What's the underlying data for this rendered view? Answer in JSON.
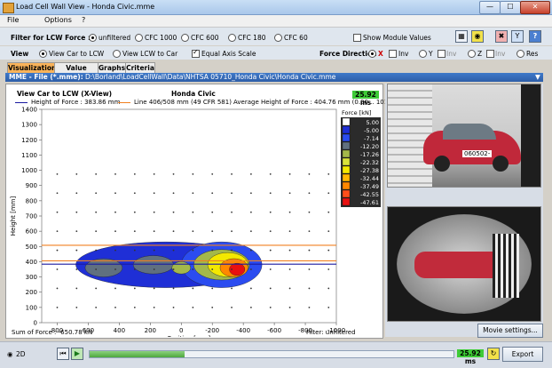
{
  "window": {
    "title": "Load Cell Wall View - Honda Civic.mme",
    "controls": {
      "minimize": "—",
      "maximize": "☐",
      "close": "✕"
    }
  },
  "menu": [
    "File",
    "Options",
    "?"
  ],
  "filter": {
    "label": "Filter for LCW Force :",
    "options": [
      "unfiltered",
      "CFC 1000",
      "CFC 600",
      "CFC 180",
      "CFC 60"
    ],
    "selected": "unfiltered",
    "show_module_values": "Show Module Values"
  },
  "view": {
    "label": "View",
    "options": [
      "View Car to LCW",
      "View LCW to Car"
    ],
    "selected": "View Car to LCW",
    "equal_axis_scale": "Equal Axis Scale",
    "force_direction_label": "Force Direction",
    "force_options": [
      "X",
      "Inv",
      "Y",
      "Inv",
      "Z",
      "Inv",
      "Res"
    ]
  },
  "tabs": [
    "Visualization",
    "Value Tables",
    "Graphs",
    "Criteria"
  ],
  "mme_file": {
    "label": "MME - File (*.mme):",
    "path": "D:\\Borland\\LoadCellWall\\Data\\NHTSA 05710_Honda Civic\\Honda Civic.mme"
  },
  "chart": {
    "header_left": "View Car to LCW (X-View)",
    "header_center": "Honda Civic",
    "time": "25.92 ms",
    "legend_height": "Height of Force : 383.86 mm",
    "legend_line": "Line 406/508 mm (49 CFR 581)",
    "avg_height": "Average Height of Force : 404.76 mm (0.00 .. 101.04 ms)",
    "sum_force": "Sum of Force : -650.78 kN",
    "filter_status": "Filter: unfiltered",
    "colorbar_title": "Force [kN]"
  },
  "chart_data": {
    "type": "heatmap",
    "xlabel": "Position [mm]",
    "ylabel": "Height [mm]",
    "xlim": [
      900,
      -1000
    ],
    "ylim": [
      0,
      1400
    ],
    "x_ticks": [
      800,
      600,
      400,
      200,
      0,
      -200,
      -400,
      -600,
      -800,
      -1000
    ],
    "y_ticks": [
      0,
      100,
      200,
      300,
      400,
      500,
      600,
      700,
      800,
      900,
      1000,
      1100,
      1200,
      1300,
      1400
    ],
    "lines": [
      {
        "name": "Height of Force",
        "y": 383.86,
        "color": "#1a1aa0"
      },
      {
        "name": "Line 406 mm",
        "y": 406,
        "color": "#f08020"
      },
      {
        "name": "Line 508 mm",
        "y": 508,
        "color": "#f08020"
      }
    ],
    "legend_levels": [
      {
        "value": "5.00",
        "color": "#ffffff"
      },
      {
        "value": "-5.00",
        "color": "#1f2fd6"
      },
      {
        "value": "-7.14",
        "color": "#2b4cf0"
      },
      {
        "value": "-12.20",
        "color": "#607080"
      },
      {
        "value": "-17.26",
        "color": "#a4b84a"
      },
      {
        "value": "-22.32",
        "color": "#d8e23a"
      },
      {
        "value": "-27.38",
        "color": "#f4e800"
      },
      {
        "value": "-32.44",
        "color": "#ffb800"
      },
      {
        "value": "-37.49",
        "color": "#ff8800"
      },
      {
        "value": "-42.55",
        "color": "#ff4e1a"
      },
      {
        "value": "-47.61",
        "color": "#e81010"
      }
    ],
    "contour_blobs": [
      {
        "x": 100,
        "y": 380,
        "rx": 580,
        "ry": 150,
        "level": 1
      },
      {
        "x": -260,
        "y": 380,
        "rx": 260,
        "ry": 150,
        "level": 2
      },
      {
        "x": 500,
        "y": 360,
        "rx": 120,
        "ry": 60,
        "level": 3
      },
      {
        "x": 180,
        "y": 380,
        "rx": 130,
        "ry": 60,
        "level": 3
      },
      {
        "x": -260,
        "y": 380,
        "rx": 180,
        "ry": 100,
        "level": 4
      },
      {
        "x": -300,
        "y": 380,
        "rx": 130,
        "ry": 80,
        "level": 6
      },
      {
        "x": -340,
        "y": 360,
        "rx": 90,
        "ry": 60,
        "level": 8
      },
      {
        "x": -360,
        "y": 350,
        "rx": 50,
        "ry": 40,
        "level": 10
      },
      {
        "x": 0,
        "y": 360,
        "rx": 60,
        "ry": 40,
        "level": 4
      }
    ]
  },
  "side": {
    "movie_settings": "Movie settings...",
    "video_label": "060502-"
  },
  "bottom": {
    "mode": "2D",
    "time": "25.92 ms",
    "export": "Export",
    "playback_fraction": 0.26
  }
}
